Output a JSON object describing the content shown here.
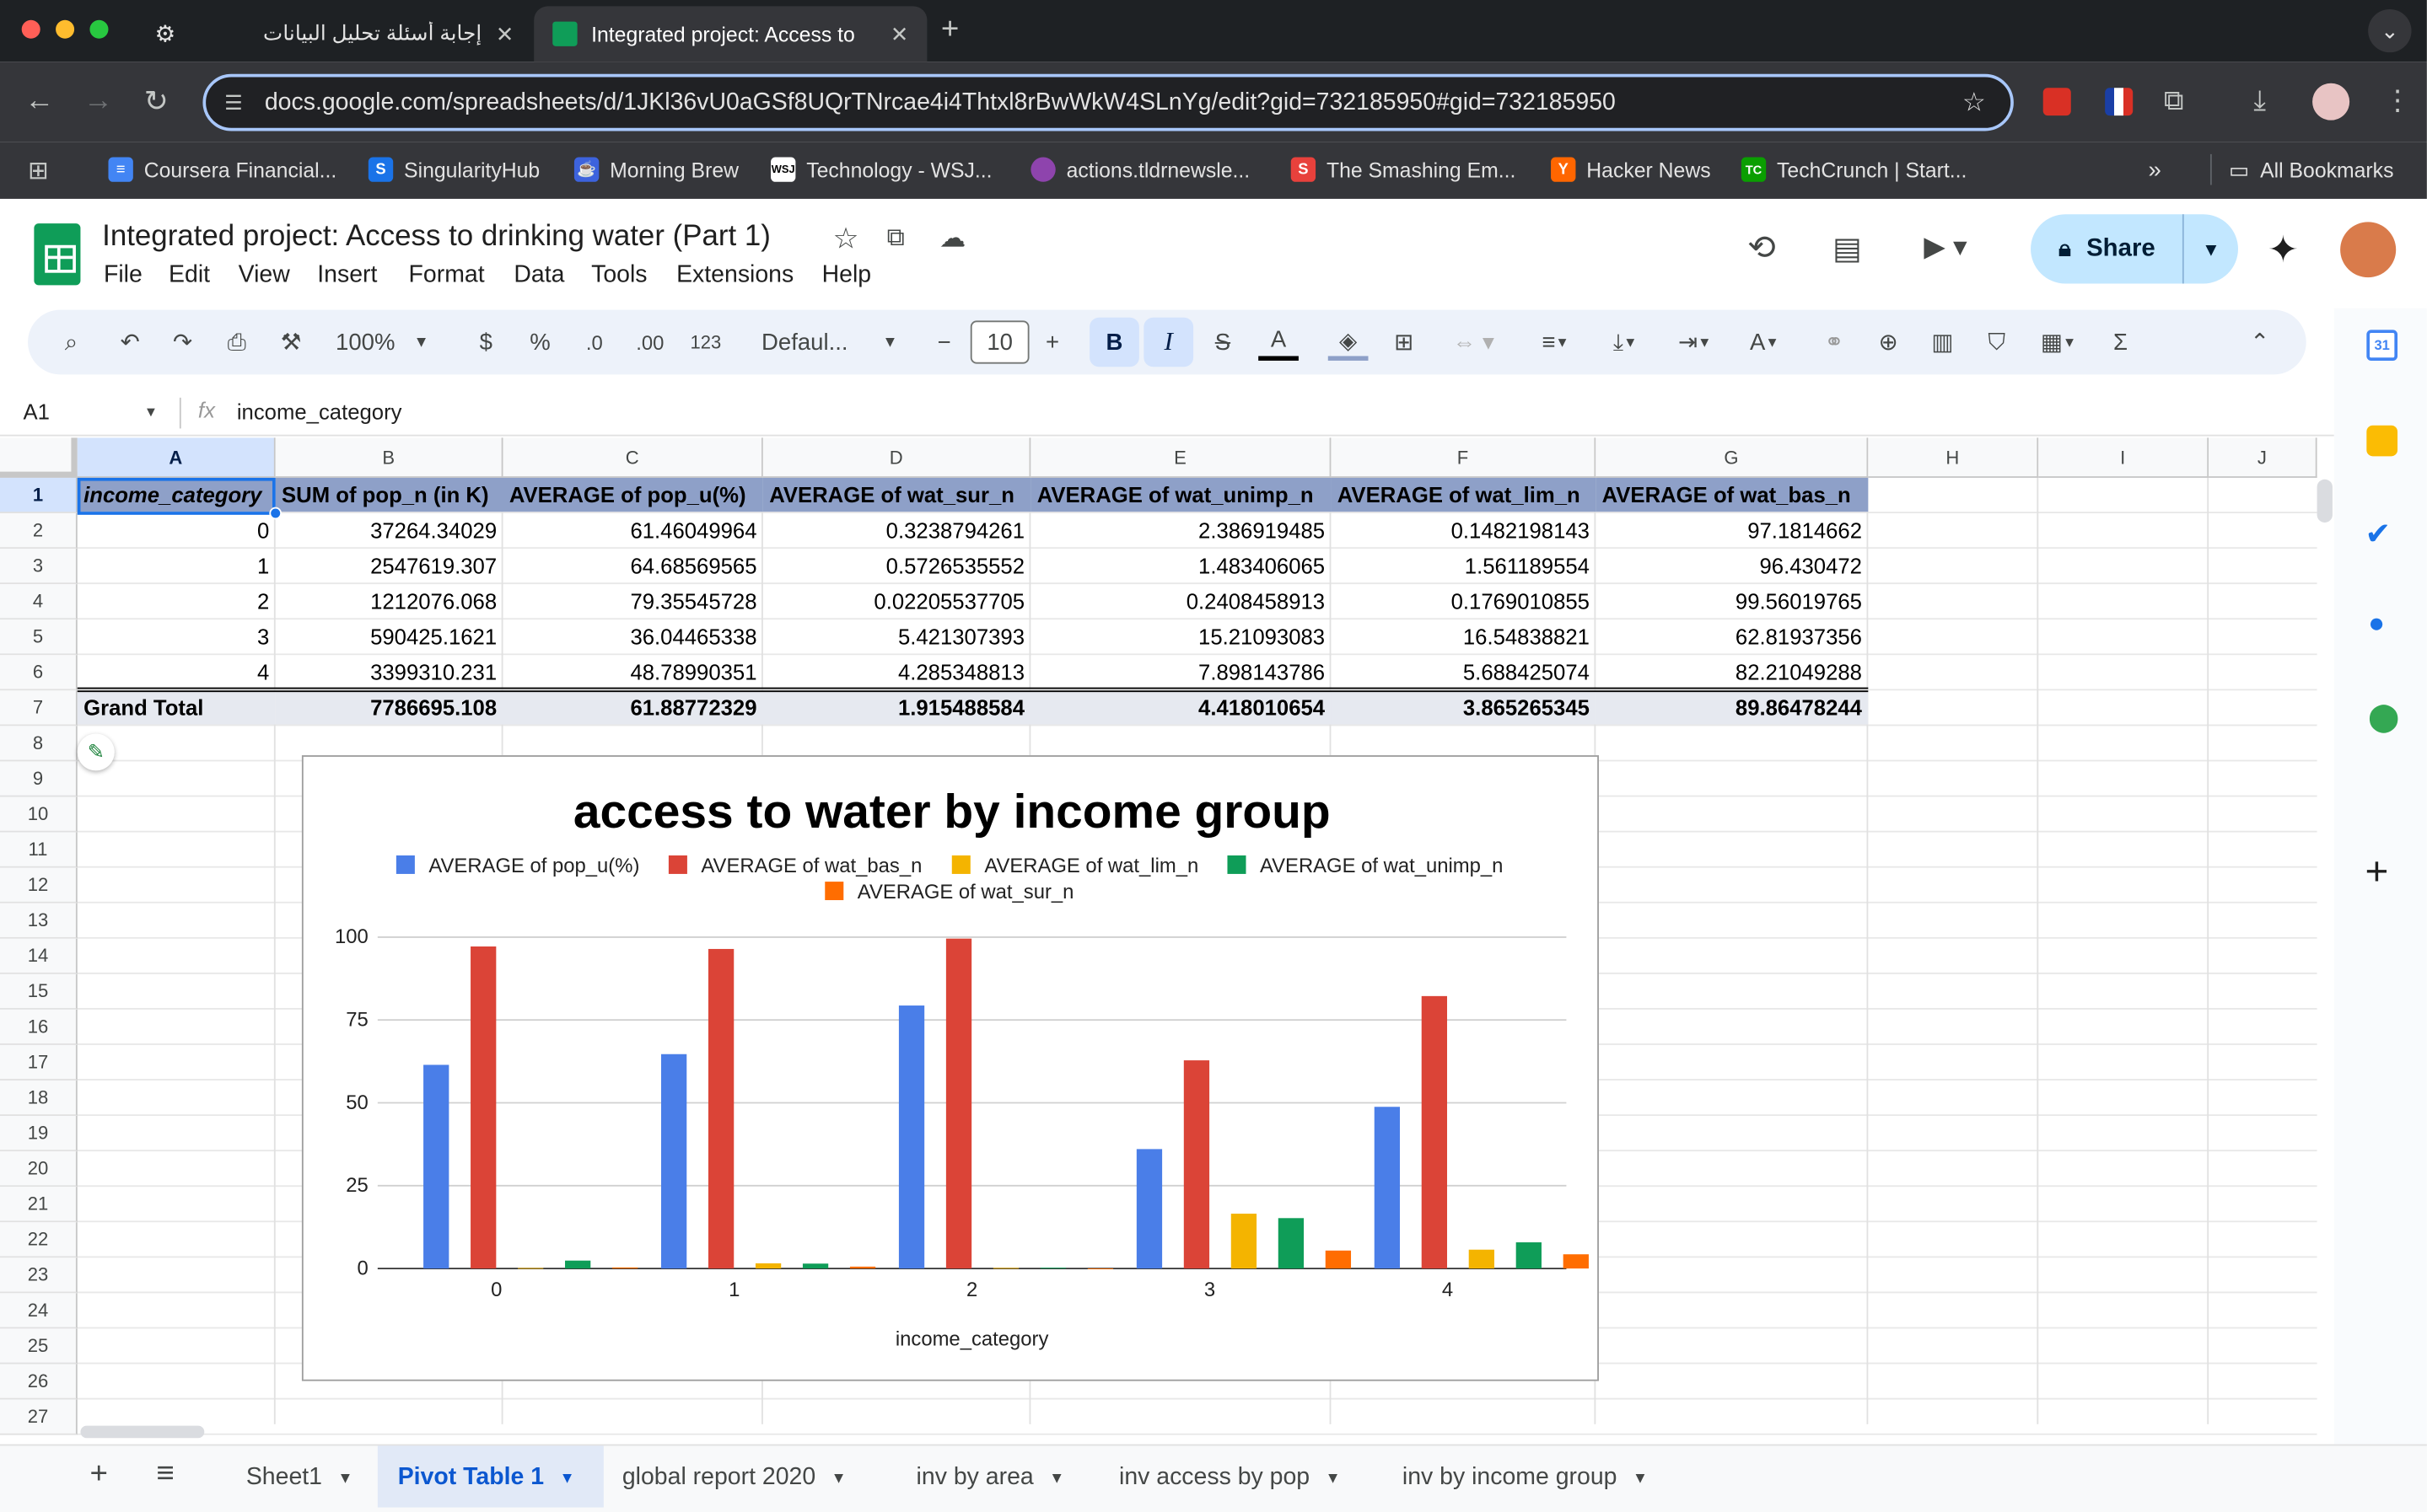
{
  "browser": {
    "tabs": [
      {
        "label": "إجابة أسئلة تحليل البيانات",
        "active": false
      },
      {
        "label": "Integrated project: Access to",
        "active": true
      }
    ],
    "new_tab": "+",
    "url": "docs.google.com/spreadsheets/d/1JKl36vU0aGSf8UQrTNrcae4i4Thtxl8rBwWkW4SLnYg/edit?gid=732185950#gid=732185950",
    "bookmarks": [
      {
        "label": "Coursera Financial...",
        "icon": "doc-icon",
        "color": "#4285f4"
      },
      {
        "label": "SingularityHub",
        "icon": "singularity-icon",
        "color": "#1a73e8"
      },
      {
        "label": "Morning Brew",
        "icon": "morning-brew-icon",
        "color": "#3d63dd"
      },
      {
        "label": "Technology - WSJ...",
        "icon": "wsj-icon",
        "color": "#ffffff"
      },
      {
        "label": "actions.tldrnewsle...",
        "icon": "tldr-icon",
        "color": "#8e44ad"
      },
      {
        "label": "The Smashing Em...",
        "icon": "smashing-icon",
        "color": "#e8413c"
      },
      {
        "label": "Hacker News",
        "icon": "hacker-news-icon",
        "color": "#ff6600"
      },
      {
        "label": "TechCrunch | Start...",
        "icon": "techcrunch-icon",
        "color": "#0a9e01"
      }
    ],
    "all_bookmarks": "All Bookmarks"
  },
  "doc": {
    "title": "Integrated project: Access to drinking water (Part 1)",
    "menu": [
      "File",
      "Edit",
      "View",
      "Insert",
      "Format",
      "Data",
      "Tools",
      "Extensions",
      "Help"
    ],
    "share_label": "Share"
  },
  "toolbar": {
    "zoom": "100%",
    "currency": "$",
    "percent": "%",
    "dec_decrease": ".0",
    "dec_increase": ".00",
    "number_format": "123",
    "font": "Defaul...",
    "font_size": "10",
    "bold": "B",
    "italic": "I",
    "sum": "Σ"
  },
  "formula_bar": {
    "cell_ref": "A1",
    "fx": "fx",
    "content": "income_category"
  },
  "grid": {
    "columns": [
      "A",
      "B",
      "C",
      "D",
      "E",
      "F",
      "G",
      "H",
      "I",
      "J"
    ],
    "rows": [
      "1",
      "2",
      "3",
      "4",
      "5",
      "6",
      "7",
      "8",
      "9",
      "10",
      "11",
      "12",
      "13",
      "14",
      "15",
      "16",
      "17",
      "18",
      "19",
      "20",
      "21",
      "22",
      "23",
      "24",
      "25",
      "26",
      "27"
    ],
    "headers": [
      "income_category",
      "SUM of pop_n (in K)",
      "AVERAGE of pop_u(%)",
      "AVERAGE of wat_sur_n",
      "AVERAGE of wat_unimp_n",
      "AVERAGE of wat_lim_n",
      "AVERAGE of wat_bas_n"
    ],
    "data": [
      [
        "0",
        "37264.34029",
        "61.46049964",
        "0.3238794261",
        "2.386919485",
        "0.1482198143",
        "97.1814662"
      ],
      [
        "1",
        "2547619.307",
        "64.68569565",
        "0.5726535552",
        "1.483406065",
        "1.561189554",
        "96.430472"
      ],
      [
        "2",
        "1212076.068",
        "79.35545728",
        "0.02205537705",
        "0.2408458913",
        "0.1769010855",
        "99.56019765"
      ],
      [
        "3",
        "590425.1621",
        "36.04465338",
        "5.421307393",
        "15.21093083",
        "16.54838821",
        "62.81937356"
      ],
      [
        "4",
        "3399310.231",
        "48.78990351",
        "4.285348813",
        "7.898143786",
        "5.688425074",
        "82.21049288"
      ]
    ],
    "total": [
      "Grand Total",
      "7786695.108",
      "61.88772329",
      "1.915488584",
      "4.418010654",
      "3.865265345",
      "89.86478244"
    ]
  },
  "chart_data": {
    "type": "bar",
    "title": "access to water by income group",
    "xlabel": "income_category",
    "ylabel": "",
    "categories": [
      "0",
      "1",
      "2",
      "3",
      "4"
    ],
    "ylim": [
      0,
      100
    ],
    "yticks": [
      "0",
      "25",
      "50",
      "75",
      "100"
    ],
    "legend_position": "top",
    "grid": true,
    "series": [
      {
        "name": "AVERAGE of pop_u(%)",
        "color": "#4a7ee8",
        "values": [
          61.46,
          64.69,
          79.36,
          36.04,
          48.79
        ]
      },
      {
        "name": "AVERAGE of wat_bas_n",
        "color": "#db4437",
        "values": [
          97.18,
          96.43,
          99.56,
          62.82,
          82.21
        ]
      },
      {
        "name": "AVERAGE of wat_lim_n",
        "color": "#f4b400",
        "values": [
          0.15,
          1.56,
          0.18,
          16.55,
          5.69
        ]
      },
      {
        "name": "AVERAGE of wat_unimp_n",
        "color": "#0f9d58",
        "values": [
          2.39,
          1.48,
          0.24,
          15.21,
          7.9
        ]
      },
      {
        "name": "AVERAGE of wat_sur_n",
        "color": "#ff6d01",
        "values": [
          0.32,
          0.57,
          0.02,
          5.42,
          4.29
        ]
      }
    ]
  },
  "sheets": [
    {
      "label": "Sheet1",
      "active": false
    },
    {
      "label": "Pivot Table 1",
      "active": true
    },
    {
      "label": "global report 2020",
      "active": false
    },
    {
      "label": "inv by area",
      "active": false
    },
    {
      "label": "inv access by pop",
      "active": false
    },
    {
      "label": "inv by income group",
      "active": false
    }
  ]
}
